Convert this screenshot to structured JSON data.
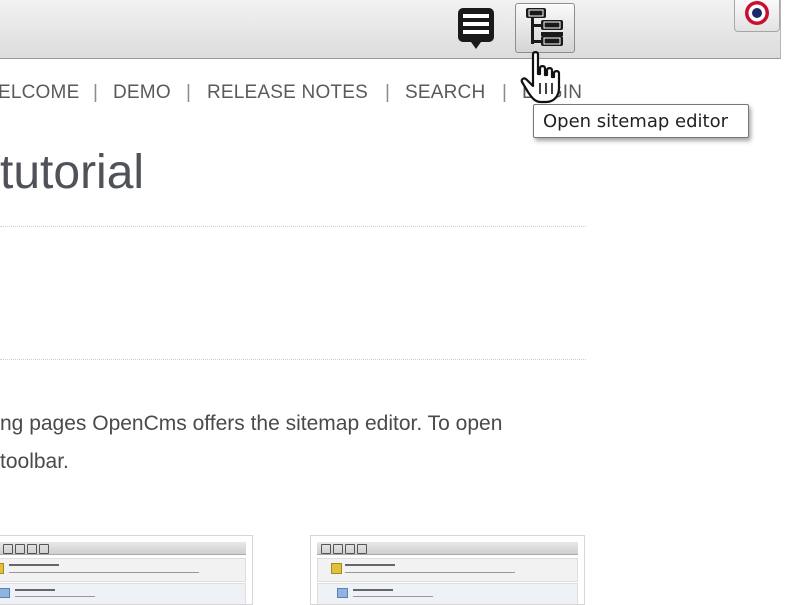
{
  "toolbar": {
    "buttons": [
      {
        "icon": "gallery-icon"
      },
      {
        "icon": "sitemap-icon",
        "pressed": true
      },
      {
        "icon": "publish-icon"
      }
    ]
  },
  "nav": {
    "items": [
      "ELCOME",
      "DEMO",
      "RELEASE NOTES",
      "SEARCH",
      "LOGIN"
    ],
    "separator": "|"
  },
  "tooltip": {
    "text": "Open sitemap editor"
  },
  "page": {
    "title": "tutorial",
    "body_line_1": "ng pages OpenCms offers the sitemap editor. To open",
    "body_line_2": " toolbar."
  },
  "colors": {
    "toolbar_top": "#f2f2f2",
    "toolbar_bottom": "#dcdcdc",
    "nav_text": "#5a5a5a",
    "title_text": "#4f5259",
    "publish_red": "#c8102e",
    "publish_blue": "#1b2a6b"
  }
}
